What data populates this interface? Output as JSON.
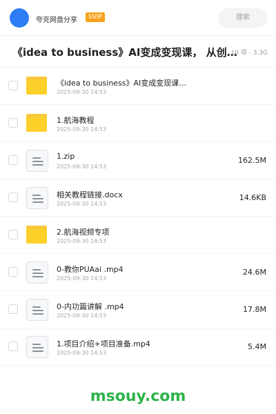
{
  "header": {
    "app_name": "夸克网盘分享",
    "badge": "SVIP",
    "search_placeholder": "搜索"
  },
  "folder": {
    "title": "《idea to business》AI变成变现课， 从创意到…",
    "item_count": "10 项",
    "separator": "·",
    "total_size": "3.3G"
  },
  "items": [
    {
      "type": "folder",
      "name": "《idea to business》AI变成变现课…",
      "date": "2025-09-30 14:53",
      "size": ""
    },
    {
      "type": "folder",
      "name": "1.航海教程",
      "date": "2025-09-30 14:53",
      "size": ""
    },
    {
      "type": "file",
      "name": "1.zip",
      "date": "2025-09-30 14:53",
      "size": "162.5M"
    },
    {
      "type": "file",
      "name": "相关教程链接.docx",
      "date": "2025-09-30 14:53",
      "size": "14.6KB"
    },
    {
      "type": "folder",
      "name": "2.航海视频专项",
      "date": "2025-09-30 14:53",
      "size": ""
    },
    {
      "type": "file",
      "name": "0-教你PUAai .mp4",
      "date": "2025-09-30 14:53",
      "size": "24.6M"
    },
    {
      "type": "file",
      "name": "0-内功篇讲解 .mp4",
      "date": "2025-09-30 14:53",
      "size": "17.8M"
    },
    {
      "type": "file",
      "name": "1.项目介绍+项目准备.mp4",
      "date": "2025-09-30 14:53",
      "size": "5.4M"
    }
  ],
  "watermark": "msouy.com",
  "colors": {
    "accent_blue": "#2f7df6",
    "svip_orange": "#f7a21b",
    "folder_yellow": "#fdd02a",
    "watermark_green": "#2db34a"
  }
}
